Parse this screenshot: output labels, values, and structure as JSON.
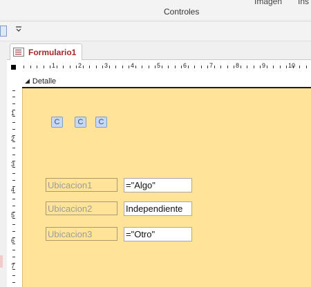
{
  "ribbon": {
    "top_label_1": "Imagen",
    "top_label_2": "Ins",
    "group_label": "Controles"
  },
  "tab": {
    "title": "Formulario1"
  },
  "section": {
    "name": "Detalle"
  },
  "ruler": {
    "horizontal": [
      "1",
      "2",
      "3",
      "4",
      "5",
      "6",
      "7",
      "8",
      "9",
      "10",
      "11"
    ],
    "vertical": [
      "1",
      "2",
      "3",
      "4",
      "5",
      "6",
      "7"
    ]
  },
  "buttons": [
    {
      "label": "C"
    },
    {
      "label": "C"
    },
    {
      "label": "C"
    }
  ],
  "fields": [
    {
      "label": "Ubicacion1",
      "value": "=\"Algo\""
    },
    {
      "label": "Ubicacion2",
      "value": "Independiente"
    },
    {
      "label": "Ubicacion3",
      "value": "=\"Otro\""
    }
  ]
}
